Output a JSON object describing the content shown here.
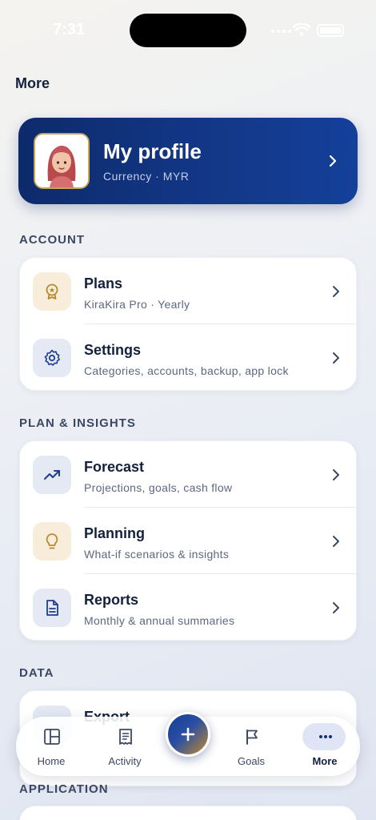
{
  "status_bar": {
    "time": "7:31"
  },
  "header": {
    "title": "More"
  },
  "profile": {
    "name": "My profile",
    "subtitle": "Currency · MYR"
  },
  "sections": {
    "account": {
      "label": "ACCOUNT",
      "items": [
        {
          "title": "Plans",
          "subtitle": "KiraKira Pro · Yearly",
          "icon": "award-icon"
        },
        {
          "title": "Settings",
          "subtitle": "Categories, accounts, backup, app lock",
          "icon": "gear-icon"
        }
      ]
    },
    "plan_insights": {
      "label": "PLAN & INSIGHTS",
      "items": [
        {
          "title": "Forecast",
          "subtitle": "Projections, goals, cash flow",
          "icon": "trend-icon"
        },
        {
          "title": "Planning",
          "subtitle": "What-if scenarios & insights",
          "icon": "lightbulb-icon"
        },
        {
          "title": "Reports",
          "subtitle": "Monthly & annual summaries",
          "icon": "document-icon"
        }
      ]
    },
    "data": {
      "label": "DATA",
      "items": [
        {
          "title": "Export",
          "icon": "export-icon"
        }
      ]
    },
    "application": {
      "label": "APPLICATION"
    }
  },
  "tabbar": {
    "home": "Home",
    "activity": "Activity",
    "goals": "Goals",
    "more": "More"
  },
  "colors": {
    "brand_navy": "#123582",
    "accent_gold": "#c9a357",
    "text_primary": "#14213d"
  }
}
